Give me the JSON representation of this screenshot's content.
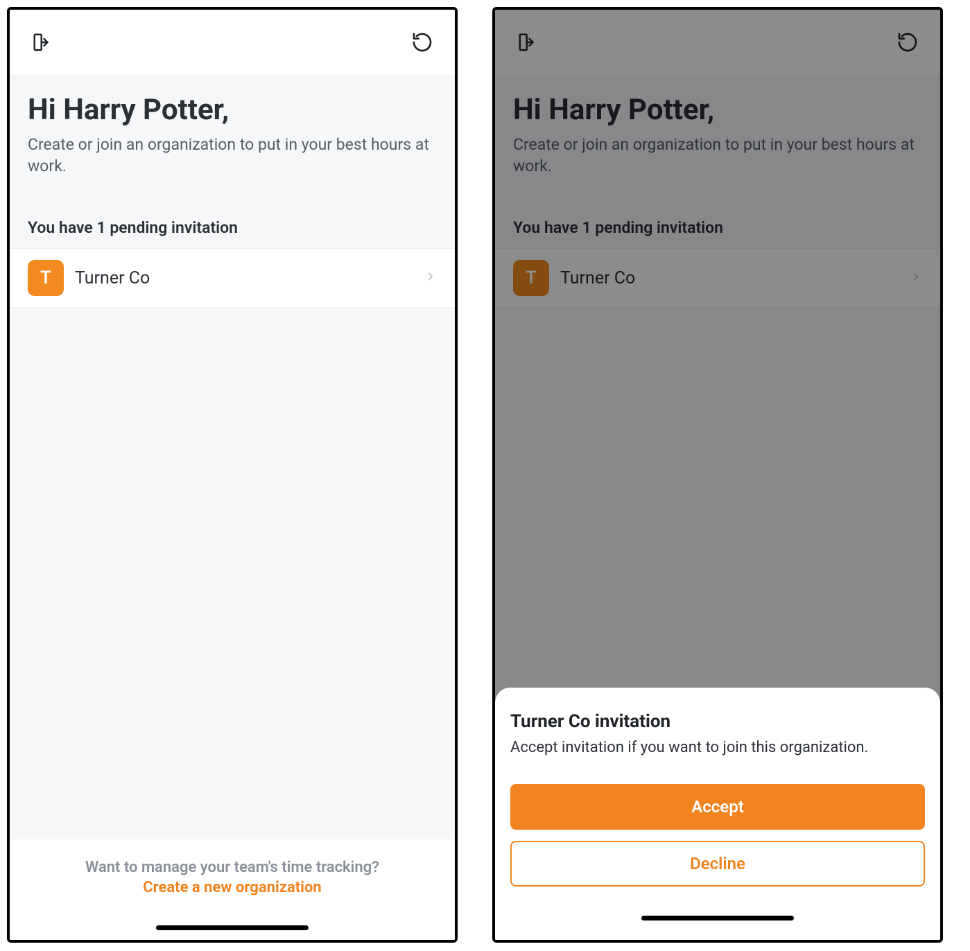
{
  "left": {
    "greeting": "Hi Harry Potter,",
    "subgreeting": "Create or join an organization to put in your best hours at work.",
    "pending_label": "You have 1 pending invitation",
    "invites": [
      {
        "initial": "T",
        "name": "Turner Co"
      }
    ],
    "footer_q": "Want to manage your team's time tracking?",
    "footer_link": "Create a new organization"
  },
  "right": {
    "greeting": "Hi Harry Potter,",
    "subgreeting": "Create or join an organization to put in your best hours at work.",
    "pending_label": "You have 1 pending invitation",
    "invites": [
      {
        "initial": "T",
        "name": "Turner Co"
      }
    ],
    "sheet": {
      "title": "Turner Co invitation",
      "desc": "Accept invitation if you want to join this organization.",
      "accept": "Accept",
      "decline": "Decline"
    }
  },
  "colors": {
    "accent": "#f2841f"
  }
}
